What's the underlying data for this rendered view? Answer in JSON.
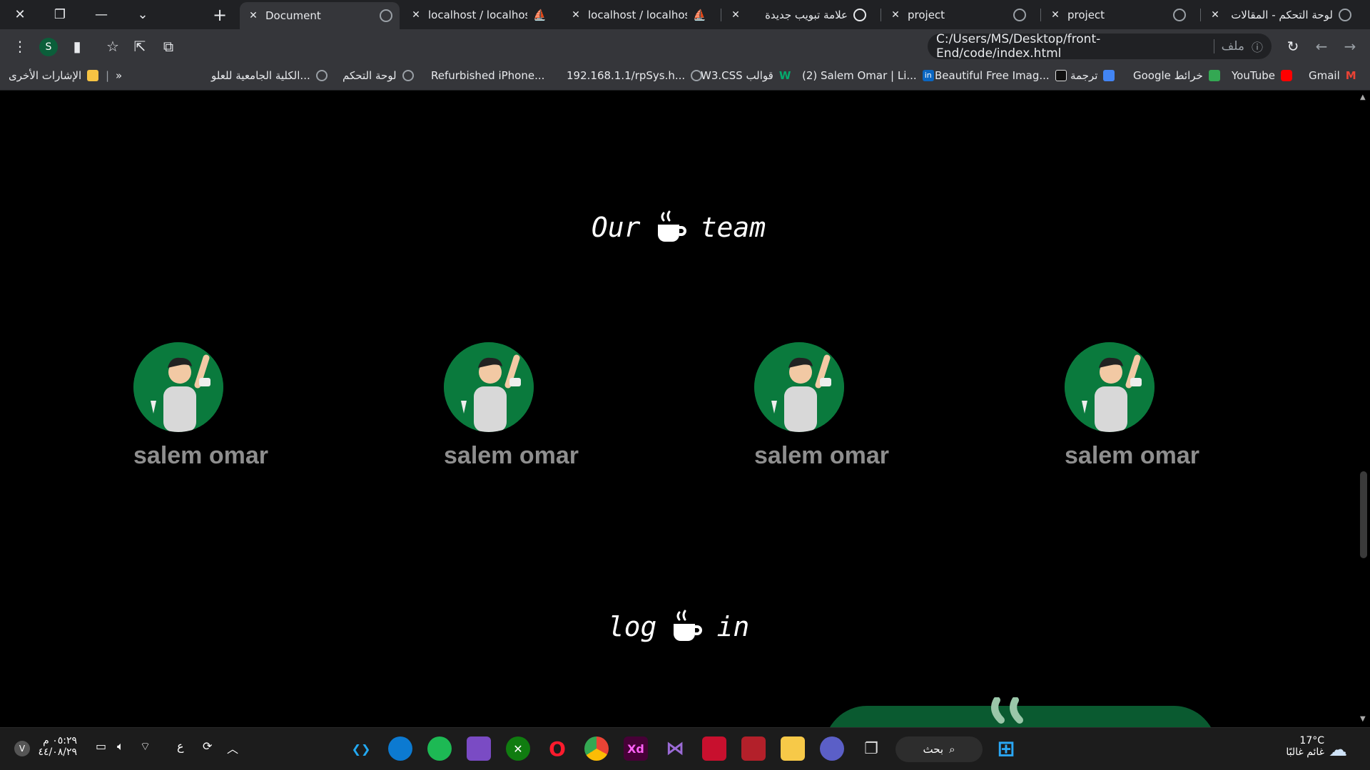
{
  "browser": {
    "tabs": [
      {
        "title": "لوحة التحكم - المقالات",
        "active": false
      },
      {
        "title": "project",
        "active": false
      },
      {
        "title": "project",
        "active": false
      },
      {
        "title": "علامة تبويب جديدة",
        "active": false
      },
      {
        "title": "localhost / localhost /",
        "active": false
      },
      {
        "title": "localhost / localhost |",
        "active": false
      },
      {
        "title": "Document",
        "active": true
      }
    ],
    "new_tab_label": "+",
    "url": "C:/Users/MS/Desktop/front-End/code/index.html",
    "url_prefix": "ملف",
    "profile_initial": "S",
    "bookmarks": [
      {
        "label": "Gmail",
        "icon_color": "#ea4335"
      },
      {
        "label": "YouTube",
        "icon_color": "#ff0000"
      },
      {
        "label": "Google خرائط",
        "icon_color": "#34a853"
      },
      {
        "label": "ترجمة",
        "icon_color": "#4285f4"
      },
      {
        "label": "Beautiful Free Imag...",
        "icon_color": "#111111"
      },
      {
        "label": "(2) Salem Omar | Li...",
        "icon_color": "#0a66c2"
      },
      {
        "label": "W3.CSS قوالب",
        "icon_color": "#04aa6d"
      },
      {
        "label": "192.168.1.1/rpSys.h...",
        "icon_color": "#9aa0a6"
      },
      {
        "label": "Refurbished iPhone...",
        "icon_color": "#9aa0a6"
      },
      {
        "label": "لوحة التحكم",
        "icon_color": "#9aa0a6"
      },
      {
        "label": "الكلية الجامعية للعلو...",
        "icon_color": "#9aa0a6"
      }
    ],
    "bookmarks_overflow": "»",
    "other_bookmarks": "الإشارات الأخرى"
  },
  "page": {
    "team_title_left": "Our",
    "team_title_right": "team",
    "members": [
      {
        "name": "salem omar"
      },
      {
        "name": "salem omar"
      },
      {
        "name": "salem omar"
      },
      {
        "name": "salem omar"
      }
    ],
    "login_title_left": "log",
    "login_title_right": "in"
  },
  "taskbar": {
    "weather_temp": "17°C",
    "weather_desc": "غائم غالبًا",
    "search_label": "بحث",
    "time": "٠٥:٢٩ م",
    "date": "٤٤/٠٨/٢٩",
    "lang": "ع",
    "apps": [
      "vscode-icon",
      "edge-icon",
      "spotify-icon",
      "clapper-icon",
      "xbox-icon",
      "opera-icon",
      "chrome-icon",
      "xd-icon",
      "visual-studio-icon",
      "app-icon",
      "app-icon-2",
      "file-explorer-icon",
      "teams-icon",
      "task-view-icon"
    ],
    "xd_label": "Xd"
  },
  "colors": {
    "accent_green": "#0a7a3d",
    "name_gray": "#8e8e8e",
    "page_bg": "#000000"
  }
}
